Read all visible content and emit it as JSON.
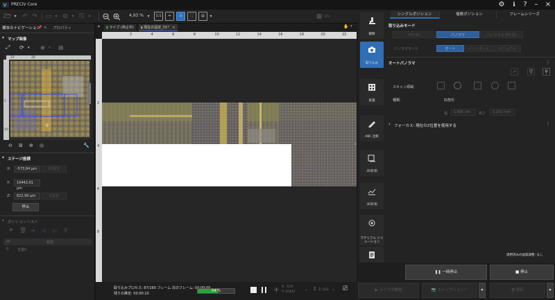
{
  "app": {
    "title": "PRECiV Core"
  },
  "toolbar": {
    "zoom_value": "4,93 %",
    "fit_label": "1:1"
  },
  "left_panel": {
    "tabs": [
      "標本のナビゲーション",
      "プロパティ"
    ],
    "map_section": "マップ画像",
    "stage_section": "ステージ座標",
    "x_label": "X:",
    "x_value": "-573,94 µm",
    "y_label": "Y:",
    "y_value": "10442,01 µm",
    "z_label": "Z:",
    "z_value": "622,90 µm",
    "xy_set_label": "XY設定",
    "z_set_label": "Z設定",
    "stop_label": "停止",
    "position_section": "ポジションリスト",
    "list_col_id": "ID",
    "list_col_name": "名前",
    "list_row_id": "0",
    "list_row_name": "位置0",
    "map_scale_marks": [
      "15",
      "20",
      "5",
      "10"
    ]
  },
  "document": {
    "tabs": [
      "ライブ (停止中)",
      "現在の設定_01*"
    ],
    "ruler_marks": [
      "2",
      "4",
      "6",
      "8",
      "10",
      "12",
      "14",
      "16",
      "18",
      "20",
      "22"
    ],
    "ruler_v_marks": [
      "2",
      "4",
      "6",
      "8"
    ]
  },
  "status": {
    "line1": "取り込みプロセス: 87/160 フレーム   次のフレーム: 00:00:00",
    "line2": "残りの推定: 00:00:10",
    "progress_percent": 54,
    "progress_label": "54 %",
    "coord_x": "X: -574",
    "coord_y": "Y: 10442",
    "z_value": "Z: 623"
  },
  "sidebar": {
    "items": [
      {
        "label": "観察",
        "icon": "microscope-icon"
      },
      {
        "label": "取り込み",
        "icon": "camera-icon"
      },
      {
        "label": "処理",
        "icon": "processing-icon"
      },
      {
        "label": "ABC 注釈",
        "icon": "annotation-icon"
      },
      {
        "label": "2D計測",
        "icon": "measure-2d-icon"
      },
      {
        "label": "3D計測",
        "icon": "measure-3d-icon"
      },
      {
        "label": "マテリアル ソリューション",
        "icon": "material-solution-icon"
      },
      {
        "label": "レポート",
        "icon": "report-icon"
      }
    ]
  },
  "right_panel": {
    "tabs": [
      "シングルポジション",
      "複数ポジション",
      "フレームシリーズ"
    ],
    "mode_title": "取り込みモード",
    "modes": [
      "EFI/3D",
      "パノラマ",
      "パノラマ & EFI/3D"
    ],
    "panorama_mode_label": "パノラマモード",
    "panorama_modes": [
      "オート",
      "インスタント",
      "マニュアル"
    ],
    "auto_panorama_title": "オートパノラマ",
    "scan_area_label": "スキャン領域:",
    "type_label": "種類:",
    "type_value": "四角形",
    "width_label": "幅",
    "width_value": "1,691 cm",
    "height_label": "高さ",
    "height_value": "0,201 mm",
    "focus_label": "フォーカス: 現在のZ位置を使用する",
    "applied_quality": "適用済みの画質調整: なし",
    "pause_label": "一時停止",
    "stop_label": "停止",
    "live_label": "ライブの開始",
    "snapshot_label": "スナップショット",
    "save_label": "保存"
  },
  "colors": {
    "accent": "#2f6fb5",
    "progress": "#27a53c"
  }
}
